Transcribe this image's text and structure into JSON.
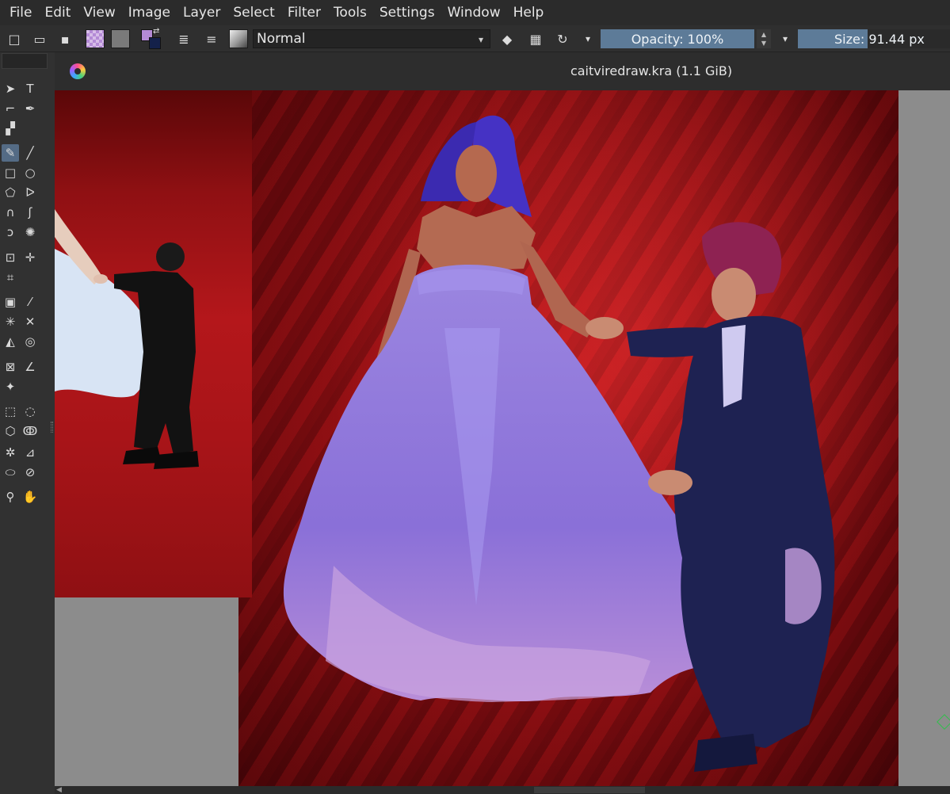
{
  "menu": [
    "File",
    "Edit",
    "View",
    "Image",
    "Layer",
    "Select",
    "Filter",
    "Tools",
    "Settings",
    "Window",
    "Help"
  ],
  "toolbar": {
    "blend_mode": "Normal",
    "opacity_label": "Opacity: 100%",
    "size_label": "Size: 91.44 px",
    "size_fill_fraction": 0.46,
    "colors": {
      "field": "#5d7b98",
      "fg_swatch": "#b48ad6",
      "bg_swatch": "#14214a"
    }
  },
  "document": {
    "title": "caitviredraw.kra (1.1 GiB)"
  },
  "icons": {
    "new": "□",
    "open": "▭",
    "save": "▪",
    "swap": "⇄",
    "wrap": "≣",
    "presets": "≡",
    "eraser": "◆",
    "alpha": "▦",
    "reload": "↻",
    "dropdown": "▾"
  },
  "tools": [
    {
      "name": "select-tool",
      "glyph": "➤"
    },
    {
      "name": "text-tool",
      "glyph": "T"
    },
    {
      "name": "edit-shapes-tool",
      "glyph": "⌐"
    },
    {
      "name": "calligraphy-tool",
      "glyph": "✒"
    },
    {
      "name": "gradient-edit-tool",
      "glyph": "▞"
    },
    {
      "name": "freehand-brush-tool",
      "glyph": "✎"
    },
    {
      "name": "line-tool",
      "glyph": "╱"
    },
    {
      "name": "rectangle-tool",
      "glyph": "□"
    },
    {
      "name": "ellipse-tool",
      "glyph": "○"
    },
    {
      "name": "polygon-tool",
      "glyph": "⬠"
    },
    {
      "name": "polyline-tool",
      "glyph": "ᐅ"
    },
    {
      "name": "bezier-tool",
      "glyph": "∩"
    },
    {
      "name": "freehand-path-tool",
      "glyph": "ʃ"
    },
    {
      "name": "dynamic-brush-tool",
      "glyph": "ↄ"
    },
    {
      "name": "multibrush-tool",
      "glyph": "✺"
    },
    {
      "name": "transform-tool",
      "glyph": "⊡"
    },
    {
      "name": "move-tool",
      "glyph": "✛"
    },
    {
      "name": "crop-tool",
      "glyph": "⌗"
    },
    {
      "name": "gradient-tool",
      "glyph": "▣"
    },
    {
      "name": "color-picker-tool",
      "glyph": "⁄"
    },
    {
      "name": "colorize-mask-tool",
      "glyph": "✳"
    },
    {
      "name": "smart-patch-tool",
      "glyph": "✕"
    },
    {
      "name": "fill-tool",
      "glyph": "◭"
    },
    {
      "name": "enclose-fill-tool",
      "glyph": "◎"
    },
    {
      "name": "assistant-tool",
      "glyph": "⊠"
    },
    {
      "name": "measure-tool",
      "glyph": "∠"
    },
    {
      "name": "reference-images-tool",
      "glyph": "✦"
    },
    {
      "name": "rect-select-tool",
      "glyph": "⬚"
    },
    {
      "name": "ellipse-select-tool",
      "glyph": "◌"
    },
    {
      "name": "polygon-select-tool",
      "glyph": "⬡"
    },
    {
      "name": "freehand-select-tool",
      "glyph": "ↂ"
    },
    {
      "name": "contiguous-select-tool",
      "glyph": "✲"
    },
    {
      "name": "similar-select-tool",
      "glyph": "⊿"
    },
    {
      "name": "bezier-select-tool",
      "glyph": "⬭"
    },
    {
      "name": "magnetic-select-tool",
      "glyph": "⊘"
    },
    {
      "name": "zoom-tool",
      "glyph": "⚲"
    },
    {
      "name": "pan-tool",
      "glyph": "✋"
    }
  ]
}
